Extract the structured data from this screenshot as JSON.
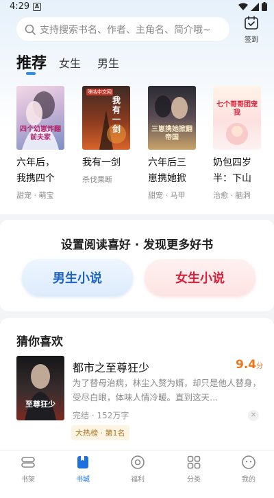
{
  "status_bar": {
    "time": "4:29",
    "app_icon_letter": "A"
  },
  "search": {
    "placeholder": "支持搜索书名、作者、主角名、简介哦~"
  },
  "checkin": {
    "label": "签到"
  },
  "tabs": [
    {
      "label": "推荐",
      "active": true
    },
    {
      "label": "女生",
      "active": false
    },
    {
      "label": "男生",
      "active": false
    }
  ],
  "books": [
    {
      "title": "六年后，",
      "title_line2": "我携四个",
      "tags": "甜宠 · 萌宝",
      "cover_text": "四个幼崽炸翻前夫家"
    },
    {
      "title": "我有一剑",
      "title_line2": "",
      "tags": "杀伐果断",
      "cover_text": "我有一剑",
      "cover_badge": "咪咕中文网"
    },
    {
      "title": "六年后三",
      "title_line2": "崽携她掀",
      "tags": "甜宠 · 马甲",
      "cover_text": "三崽携她掀翻帝国"
    },
    {
      "title": "奶包四岁",
      "title_line2": "半：下山",
      "tags": "治愈 · 脑洞",
      "cover_text": "七个哥哥团宠我"
    }
  ],
  "preference": {
    "title": "设置阅读喜好 · 发现更多好书",
    "male_label": "男生小说",
    "female_label": "女生小说"
  },
  "guess": {
    "title": "猜你喜欢",
    "book_title": "都市之至尊狂少",
    "score": "9.4",
    "score_unit": "分",
    "desc": "为了替母治病，林尘入赘为婿，却只是他人替身，受尽白眼，体味人情冷暖。直到这天…",
    "meta": "完结 · 152万字",
    "rank": "大热榜 · 第1名",
    "cover_text": "至尊狂少"
  },
  "bottom_nav": [
    {
      "label": "书架",
      "icon": "bookshelf-icon",
      "active": false
    },
    {
      "label": "书城",
      "icon": "bookstore-icon",
      "active": true
    },
    {
      "label": "福利",
      "icon": "welfare-icon",
      "active": false
    },
    {
      "label": "分类",
      "icon": "category-icon",
      "active": false
    },
    {
      "label": "我的",
      "icon": "profile-icon",
      "active": false
    }
  ],
  "colors": {
    "accent": "#2c8ef0",
    "nav_active": "#1e6fe0",
    "score": "#f0761c",
    "male": "#1d63c9",
    "female": "#d8213a"
  }
}
